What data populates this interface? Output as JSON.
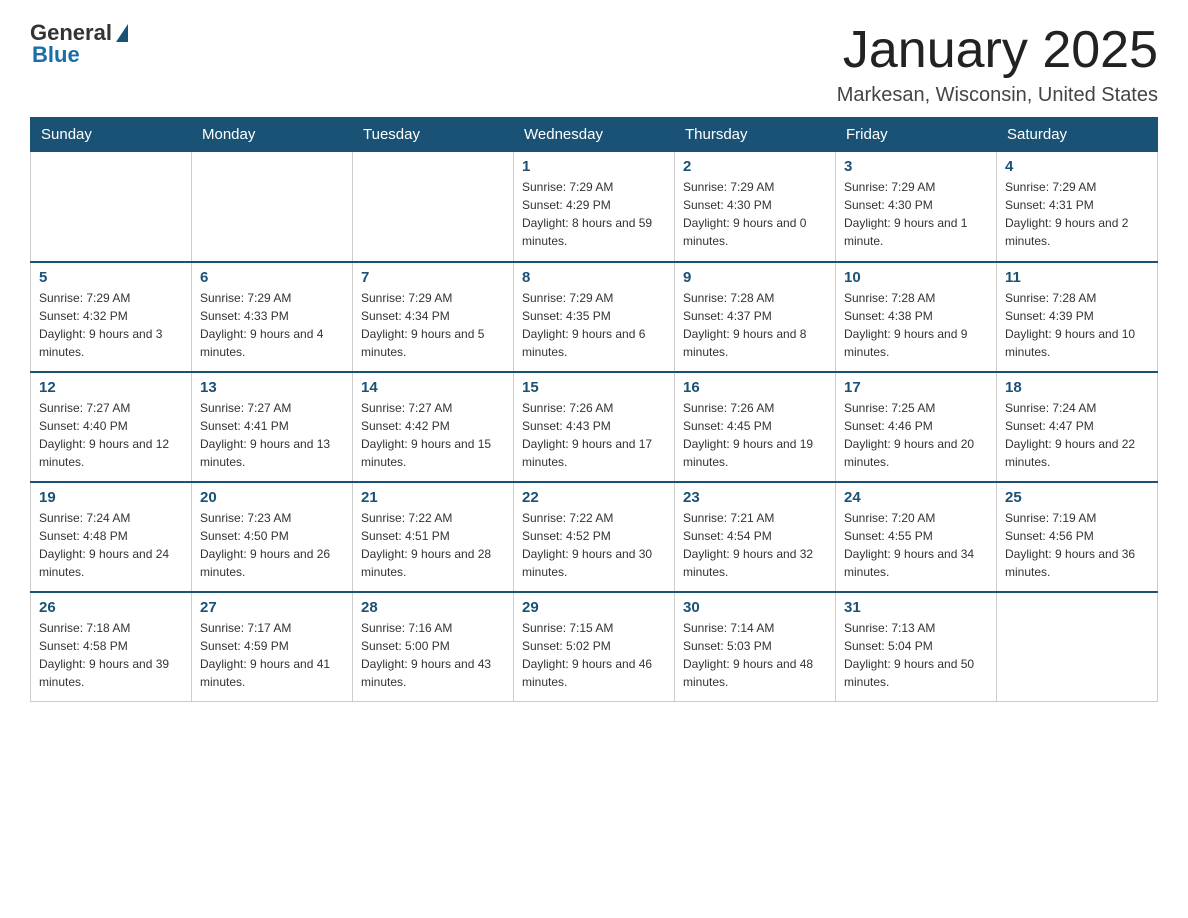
{
  "header": {
    "logo_general": "General",
    "logo_blue": "Blue",
    "month_title": "January 2025",
    "location": "Markesan, Wisconsin, United States"
  },
  "days_of_week": [
    "Sunday",
    "Monday",
    "Tuesday",
    "Wednesday",
    "Thursday",
    "Friday",
    "Saturday"
  ],
  "weeks": [
    [
      {
        "day": "",
        "sunrise": "",
        "sunset": "",
        "daylight": ""
      },
      {
        "day": "",
        "sunrise": "",
        "sunset": "",
        "daylight": ""
      },
      {
        "day": "",
        "sunrise": "",
        "sunset": "",
        "daylight": ""
      },
      {
        "day": "1",
        "sunrise": "Sunrise: 7:29 AM",
        "sunset": "Sunset: 4:29 PM",
        "daylight": "Daylight: 8 hours and 59 minutes."
      },
      {
        "day": "2",
        "sunrise": "Sunrise: 7:29 AM",
        "sunset": "Sunset: 4:30 PM",
        "daylight": "Daylight: 9 hours and 0 minutes."
      },
      {
        "day": "3",
        "sunrise": "Sunrise: 7:29 AM",
        "sunset": "Sunset: 4:30 PM",
        "daylight": "Daylight: 9 hours and 1 minute."
      },
      {
        "day": "4",
        "sunrise": "Sunrise: 7:29 AM",
        "sunset": "Sunset: 4:31 PM",
        "daylight": "Daylight: 9 hours and 2 minutes."
      }
    ],
    [
      {
        "day": "5",
        "sunrise": "Sunrise: 7:29 AM",
        "sunset": "Sunset: 4:32 PM",
        "daylight": "Daylight: 9 hours and 3 minutes."
      },
      {
        "day": "6",
        "sunrise": "Sunrise: 7:29 AM",
        "sunset": "Sunset: 4:33 PM",
        "daylight": "Daylight: 9 hours and 4 minutes."
      },
      {
        "day": "7",
        "sunrise": "Sunrise: 7:29 AM",
        "sunset": "Sunset: 4:34 PM",
        "daylight": "Daylight: 9 hours and 5 minutes."
      },
      {
        "day": "8",
        "sunrise": "Sunrise: 7:29 AM",
        "sunset": "Sunset: 4:35 PM",
        "daylight": "Daylight: 9 hours and 6 minutes."
      },
      {
        "day": "9",
        "sunrise": "Sunrise: 7:28 AM",
        "sunset": "Sunset: 4:37 PM",
        "daylight": "Daylight: 9 hours and 8 minutes."
      },
      {
        "day": "10",
        "sunrise": "Sunrise: 7:28 AM",
        "sunset": "Sunset: 4:38 PM",
        "daylight": "Daylight: 9 hours and 9 minutes."
      },
      {
        "day": "11",
        "sunrise": "Sunrise: 7:28 AM",
        "sunset": "Sunset: 4:39 PM",
        "daylight": "Daylight: 9 hours and 10 minutes."
      }
    ],
    [
      {
        "day": "12",
        "sunrise": "Sunrise: 7:27 AM",
        "sunset": "Sunset: 4:40 PM",
        "daylight": "Daylight: 9 hours and 12 minutes."
      },
      {
        "day": "13",
        "sunrise": "Sunrise: 7:27 AM",
        "sunset": "Sunset: 4:41 PM",
        "daylight": "Daylight: 9 hours and 13 minutes."
      },
      {
        "day": "14",
        "sunrise": "Sunrise: 7:27 AM",
        "sunset": "Sunset: 4:42 PM",
        "daylight": "Daylight: 9 hours and 15 minutes."
      },
      {
        "day": "15",
        "sunrise": "Sunrise: 7:26 AM",
        "sunset": "Sunset: 4:43 PM",
        "daylight": "Daylight: 9 hours and 17 minutes."
      },
      {
        "day": "16",
        "sunrise": "Sunrise: 7:26 AM",
        "sunset": "Sunset: 4:45 PM",
        "daylight": "Daylight: 9 hours and 19 minutes."
      },
      {
        "day": "17",
        "sunrise": "Sunrise: 7:25 AM",
        "sunset": "Sunset: 4:46 PM",
        "daylight": "Daylight: 9 hours and 20 minutes."
      },
      {
        "day": "18",
        "sunrise": "Sunrise: 7:24 AM",
        "sunset": "Sunset: 4:47 PM",
        "daylight": "Daylight: 9 hours and 22 minutes."
      }
    ],
    [
      {
        "day": "19",
        "sunrise": "Sunrise: 7:24 AM",
        "sunset": "Sunset: 4:48 PM",
        "daylight": "Daylight: 9 hours and 24 minutes."
      },
      {
        "day": "20",
        "sunrise": "Sunrise: 7:23 AM",
        "sunset": "Sunset: 4:50 PM",
        "daylight": "Daylight: 9 hours and 26 minutes."
      },
      {
        "day": "21",
        "sunrise": "Sunrise: 7:22 AM",
        "sunset": "Sunset: 4:51 PM",
        "daylight": "Daylight: 9 hours and 28 minutes."
      },
      {
        "day": "22",
        "sunrise": "Sunrise: 7:22 AM",
        "sunset": "Sunset: 4:52 PM",
        "daylight": "Daylight: 9 hours and 30 minutes."
      },
      {
        "day": "23",
        "sunrise": "Sunrise: 7:21 AM",
        "sunset": "Sunset: 4:54 PM",
        "daylight": "Daylight: 9 hours and 32 minutes."
      },
      {
        "day": "24",
        "sunrise": "Sunrise: 7:20 AM",
        "sunset": "Sunset: 4:55 PM",
        "daylight": "Daylight: 9 hours and 34 minutes."
      },
      {
        "day": "25",
        "sunrise": "Sunrise: 7:19 AM",
        "sunset": "Sunset: 4:56 PM",
        "daylight": "Daylight: 9 hours and 36 minutes."
      }
    ],
    [
      {
        "day": "26",
        "sunrise": "Sunrise: 7:18 AM",
        "sunset": "Sunset: 4:58 PM",
        "daylight": "Daylight: 9 hours and 39 minutes."
      },
      {
        "day": "27",
        "sunrise": "Sunrise: 7:17 AM",
        "sunset": "Sunset: 4:59 PM",
        "daylight": "Daylight: 9 hours and 41 minutes."
      },
      {
        "day": "28",
        "sunrise": "Sunrise: 7:16 AM",
        "sunset": "Sunset: 5:00 PM",
        "daylight": "Daylight: 9 hours and 43 minutes."
      },
      {
        "day": "29",
        "sunrise": "Sunrise: 7:15 AM",
        "sunset": "Sunset: 5:02 PM",
        "daylight": "Daylight: 9 hours and 46 minutes."
      },
      {
        "day": "30",
        "sunrise": "Sunrise: 7:14 AM",
        "sunset": "Sunset: 5:03 PM",
        "daylight": "Daylight: 9 hours and 48 minutes."
      },
      {
        "day": "31",
        "sunrise": "Sunrise: 7:13 AM",
        "sunset": "Sunset: 5:04 PM",
        "daylight": "Daylight: 9 hours and 50 minutes."
      },
      {
        "day": "",
        "sunrise": "",
        "sunset": "",
        "daylight": ""
      }
    ]
  ]
}
